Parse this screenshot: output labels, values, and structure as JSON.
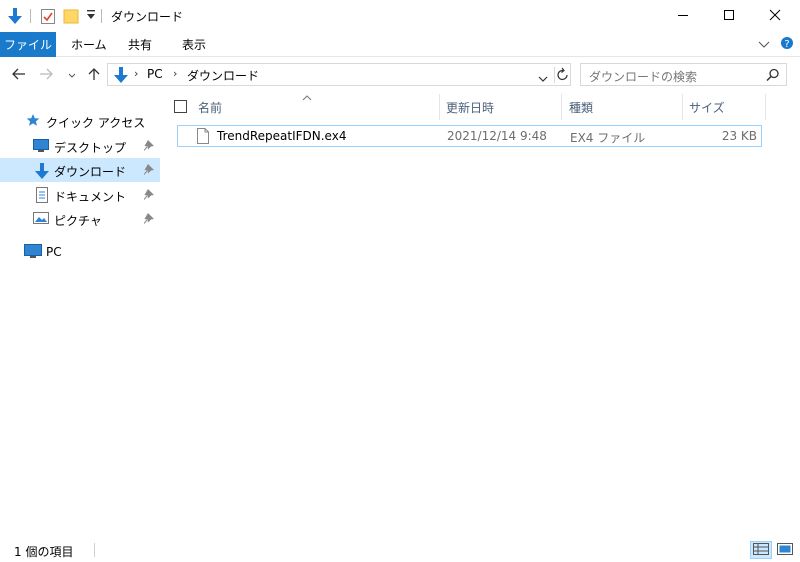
{
  "window": {
    "title": "ダウンロード"
  },
  "ribbon": {
    "tabs": [
      "ファイル",
      "ホーム",
      "共有",
      "表示"
    ]
  },
  "address": {
    "crumbs": [
      "PC",
      "ダウンロード"
    ]
  },
  "search": {
    "placeholder": "ダウンロードの検索"
  },
  "nav": {
    "quick_access": "クイック アクセス",
    "items": [
      {
        "label": "デスクトップ",
        "icon": "desktop-icon",
        "pinned": true
      },
      {
        "label": "ダウンロード",
        "icon": "download-arrow-icon",
        "pinned": true,
        "selected": true
      },
      {
        "label": "ドキュメント",
        "icon": "document-icon",
        "pinned": true
      },
      {
        "label": "ピクチャ",
        "icon": "picture-icon",
        "pinned": true
      }
    ],
    "pc": "PC"
  },
  "filelist": {
    "columns": [
      "名前",
      "更新日時",
      "種類",
      "サイズ"
    ],
    "rows": [
      {
        "name": "TrendRepeatIFDN.ex4",
        "modified": "2021/12/14 9:48",
        "type": "EX4 ファイル",
        "size": "23 KB"
      }
    ]
  },
  "status": {
    "count_text": "1 個の項目"
  },
  "colors": {
    "accent": "#1979ca",
    "selection": "#cce8ff",
    "selection_border": "#99d1ff",
    "header_text": "#4c607a"
  }
}
